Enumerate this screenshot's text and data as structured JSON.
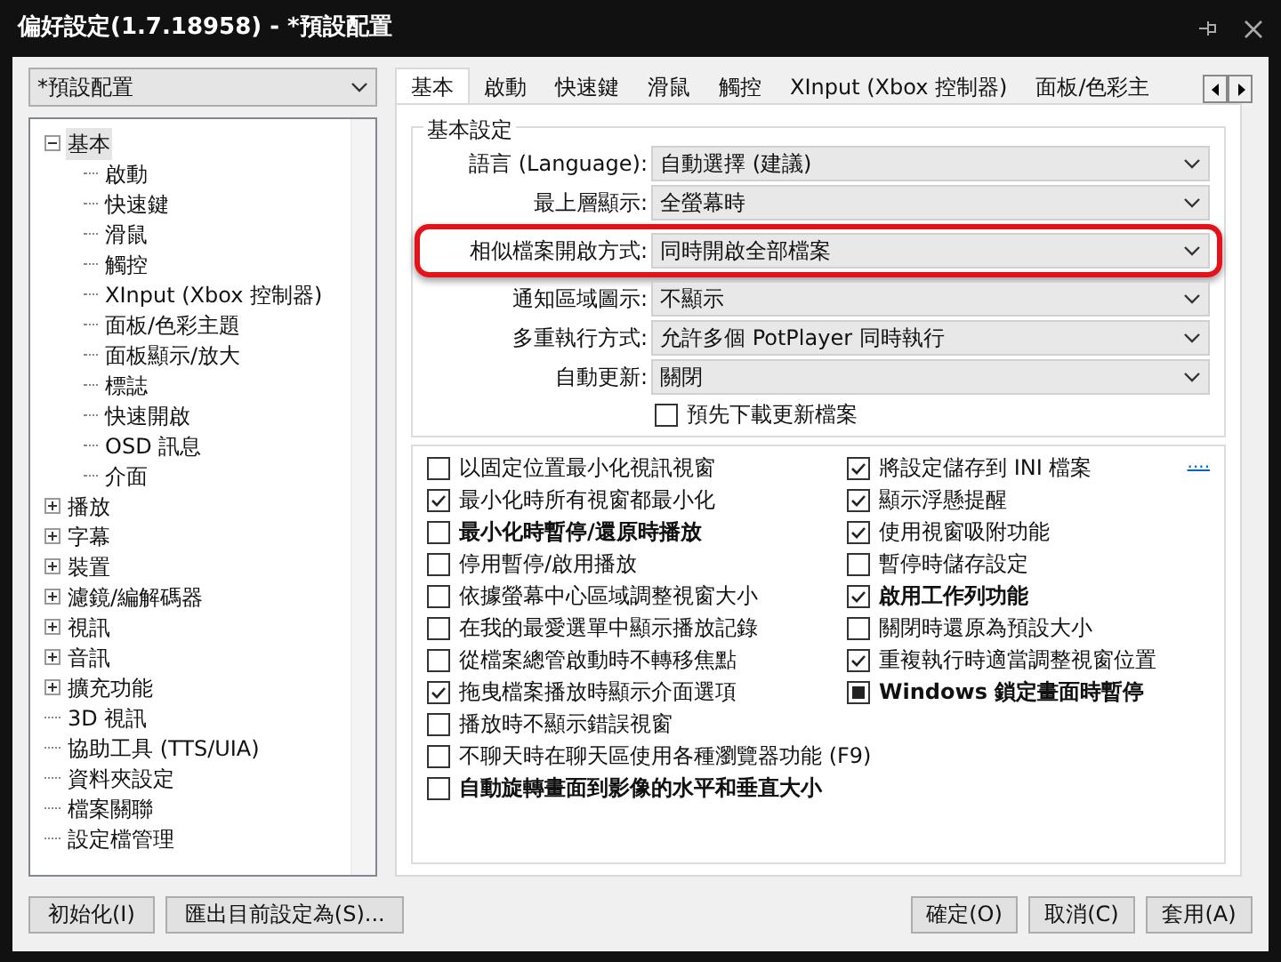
{
  "window": {
    "title": "偏好設定(1.7.18958) - *預設配置"
  },
  "profile": {
    "value": "*預設配置"
  },
  "tree": [
    {
      "label": "基本",
      "selected": true,
      "expanded": true,
      "children": [
        {
          "label": "啟動",
          "selected": false
        },
        {
          "label": "快速鍵",
          "selected": false
        },
        {
          "label": "滑鼠",
          "selected": false
        },
        {
          "label": "觸控",
          "selected": false
        },
        {
          "label": "XInput (Xbox 控制器)",
          "selected": false
        },
        {
          "label": "面板/色彩主題",
          "selected": false
        },
        {
          "label": "面板顯示/放大",
          "selected": false
        },
        {
          "label": "標誌",
          "selected": false
        },
        {
          "label": "快速開啟",
          "selected": false
        },
        {
          "label": "OSD 訊息",
          "selected": false
        },
        {
          "label": "介面",
          "selected": false
        }
      ]
    },
    {
      "label": "播放",
      "selected": false,
      "expanded": false
    },
    {
      "label": "字幕",
      "selected": false,
      "expanded": false
    },
    {
      "label": "裝置",
      "selected": false,
      "expanded": false
    },
    {
      "label": "濾鏡/編解碼器",
      "selected": false,
      "expanded": false
    },
    {
      "label": "視訊",
      "selected": false,
      "expanded": false
    },
    {
      "label": "音訊",
      "selected": false,
      "expanded": false
    },
    {
      "label": "擴充功能",
      "selected": false,
      "expanded": false
    },
    {
      "label": "3D 視訊",
      "selected": false
    },
    {
      "label": "協助工具 (TTS/UIA)",
      "selected": false
    },
    {
      "label": "資料夾設定",
      "selected": false
    },
    {
      "label": "檔案關聯",
      "selected": false
    },
    {
      "label": "設定檔管理",
      "selected": false
    }
  ],
  "tabs": [
    {
      "label": "基本",
      "selected": true
    },
    {
      "label": "啟動",
      "selected": false
    },
    {
      "label": "快速鍵",
      "selected": false
    },
    {
      "label": "滑鼠",
      "selected": false
    },
    {
      "label": "觸控",
      "selected": false
    },
    {
      "label": "XInput (Xbox 控制器)",
      "selected": false
    },
    {
      "label": "面板/色彩主",
      "selected": false
    }
  ],
  "group": {
    "title": "基本設定"
  },
  "settings": [
    {
      "label": "語言 (Language):",
      "value": "自動選擇 (建議)",
      "highlighted": false
    },
    {
      "label": "最上層顯示:",
      "value": "全螢幕時",
      "highlighted": false
    },
    {
      "label": "相似檔案開啟方式:",
      "value": "同時開啟全部檔案",
      "highlighted": true
    },
    {
      "label": "通知區域圖示:",
      "value": "不顯示",
      "highlighted": false
    },
    {
      "label": "多重執行方式:",
      "value": "允許多個 PotPlayer 同時執行",
      "highlighted": false
    },
    {
      "label": "自動更新:",
      "value": "關閉",
      "highlighted": false
    }
  ],
  "predownload": {
    "label": "預先下載更新檔案",
    "checked": false
  },
  "more_link": "....",
  "options_left": [
    {
      "label": "以固定位置最小化視訊視窗",
      "checked": false,
      "indeterminate": false,
      "bold": false
    },
    {
      "label": "最小化時所有視窗都最小化",
      "checked": true,
      "indeterminate": false,
      "bold": false
    },
    {
      "label": "最小化時暫停/還原時播放",
      "checked": false,
      "indeterminate": false,
      "bold": true
    },
    {
      "label": "停用暫停/啟用播放",
      "checked": false,
      "indeterminate": false,
      "bold": false
    },
    {
      "label": "依據螢幕中心區域調整視窗大小",
      "checked": false,
      "indeterminate": false,
      "bold": false
    },
    {
      "label": "在我的最愛選單中顯示播放記錄",
      "checked": false,
      "indeterminate": false,
      "bold": false
    },
    {
      "label": "從檔案總管啟動時不轉移焦點",
      "checked": false,
      "indeterminate": false,
      "bold": false
    },
    {
      "label": "拖曳檔案播放時顯示介面選項",
      "checked": true,
      "indeterminate": false,
      "bold": false
    },
    {
      "label": "播放時不顯示錯誤視窗",
      "checked": false,
      "indeterminate": false,
      "bold": false
    }
  ],
  "options_right": [
    {
      "label": "將設定儲存到 INI 檔案",
      "checked": true,
      "indeterminate": false,
      "bold": false
    },
    {
      "label": "顯示浮懸提醒",
      "checked": true,
      "indeterminate": false,
      "bold": false
    },
    {
      "label": "使用視窗吸附功能",
      "checked": true,
      "indeterminate": false,
      "bold": false
    },
    {
      "label": "暫停時儲存設定",
      "checked": false,
      "indeterminate": false,
      "bold": false
    },
    {
      "label": "啟用工作列功能",
      "checked": true,
      "indeterminate": false,
      "bold": true
    },
    {
      "label": "關閉時還原為預設大小",
      "checked": false,
      "indeterminate": false,
      "bold": false
    },
    {
      "label": "重複執行時適當調整視窗位置",
      "checked": true,
      "indeterminate": false,
      "bold": false
    },
    {
      "label": "Windows 鎖定畫面時暫停",
      "checked": false,
      "indeterminate": true,
      "bold": true
    }
  ],
  "options_wide": [
    {
      "label": "不聊天時在聊天區使用各種瀏覽器功能 (F9)",
      "checked": false,
      "indeterminate": false,
      "bold": false
    },
    {
      "label": "自動旋轉畫面到影像的水平和垂直大小",
      "checked": false,
      "indeterminate": false,
      "bold": true
    }
  ],
  "buttons_left": [
    "初始化(I)",
    "匯出目前設定為(S)..."
  ],
  "buttons_right": [
    "確定(O)",
    "取消(C)",
    "套用(A)"
  ]
}
